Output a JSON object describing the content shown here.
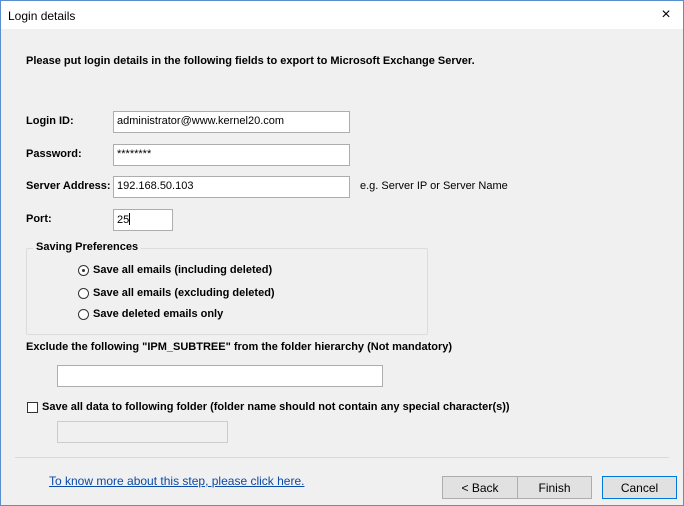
{
  "window": {
    "title": "Login details",
    "close_glyph": "×"
  },
  "instructions": "Please put login details in the following fields to export to Microsoft Exchange Server.",
  "fields": {
    "login_id": {
      "label": "Login ID:",
      "value": "administrator@www.kernel20.com"
    },
    "password": {
      "label": "Password:",
      "value": "********"
    },
    "server": {
      "label": "Server Address:",
      "value": "192.168.50.103",
      "hint": "e.g. Server IP or Server Name"
    },
    "port": {
      "label": "Port:",
      "value": "25"
    }
  },
  "saving_preferences": {
    "title": "Saving Preferences",
    "options": [
      {
        "label": "Save all emails (including deleted)",
        "checked": true
      },
      {
        "label": "Save all emails (excluding deleted)",
        "checked": false
      },
      {
        "label": "Save deleted emails only",
        "checked": false
      }
    ]
  },
  "exclude": {
    "label": "Exclude the following \"IPM_SUBTREE\" from the folder hierarchy (Not mandatory)",
    "value": ""
  },
  "save_folder": {
    "label": "Save all data to following folder (folder name should not contain any special character(s))",
    "checked": false,
    "value": ""
  },
  "footer": {
    "link": "To know more about this step, please click here.",
    "back": "< Back",
    "finish": "Finish",
    "cancel": "Cancel"
  },
  "colors": {
    "border": "#5a8fcf",
    "link": "#0b4aa8",
    "focus": "#0078d7"
  }
}
